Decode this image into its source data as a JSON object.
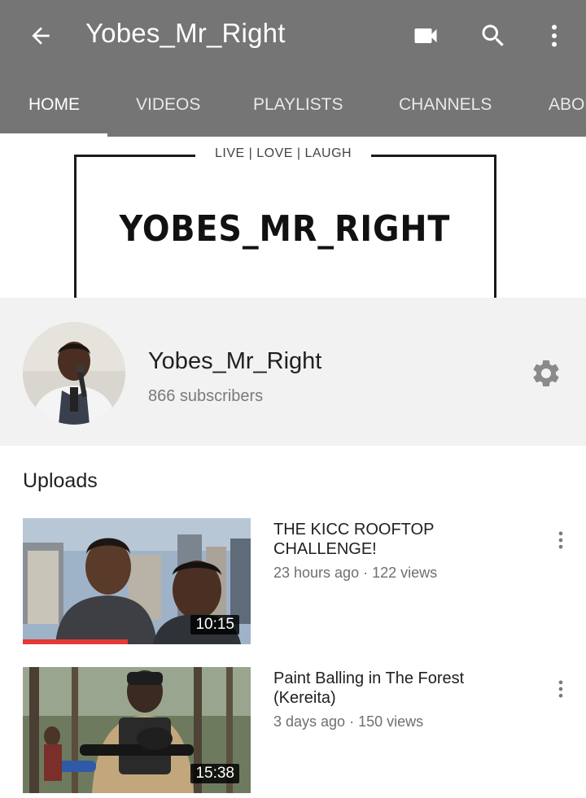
{
  "app_bar": {
    "title": "Yobes_Mr_Right",
    "back_icon": "arrow-left-icon",
    "actions": [
      "video-camera-icon",
      "search-icon",
      "more-vert-icon"
    ]
  },
  "tabs": [
    {
      "label": "HOME",
      "active": true
    },
    {
      "label": "VIDEOS",
      "active": false
    },
    {
      "label": "PLAYLISTS",
      "active": false
    },
    {
      "label": "CHANNELS",
      "active": false
    },
    {
      "label": "ABOUT",
      "active": false
    }
  ],
  "banner": {
    "tagline": "LIVE | LOVE | LAUGH",
    "logo_text": "YOBES_MR_RIGHT"
  },
  "channel": {
    "name": "Yobes_Mr_Right",
    "subscribers": "866 subscribers",
    "settings_icon": "gear-icon"
  },
  "uploads": {
    "heading": "Uploads",
    "videos": [
      {
        "title": "THE KICC ROOFTOP CHALLENGE!",
        "meta": "23 hours ago · 122 views",
        "duration": "10:15",
        "watched_fraction": 0.46
      },
      {
        "title": "Paint Balling in The Forest (Kereita)",
        "meta": "3 days ago · 150 views",
        "duration": "15:38",
        "watched_fraction": 0
      }
    ]
  },
  "colors": {
    "app_bar": "#757575",
    "progress": "#e53935",
    "channel_header_bg": "#f2f2f2"
  }
}
